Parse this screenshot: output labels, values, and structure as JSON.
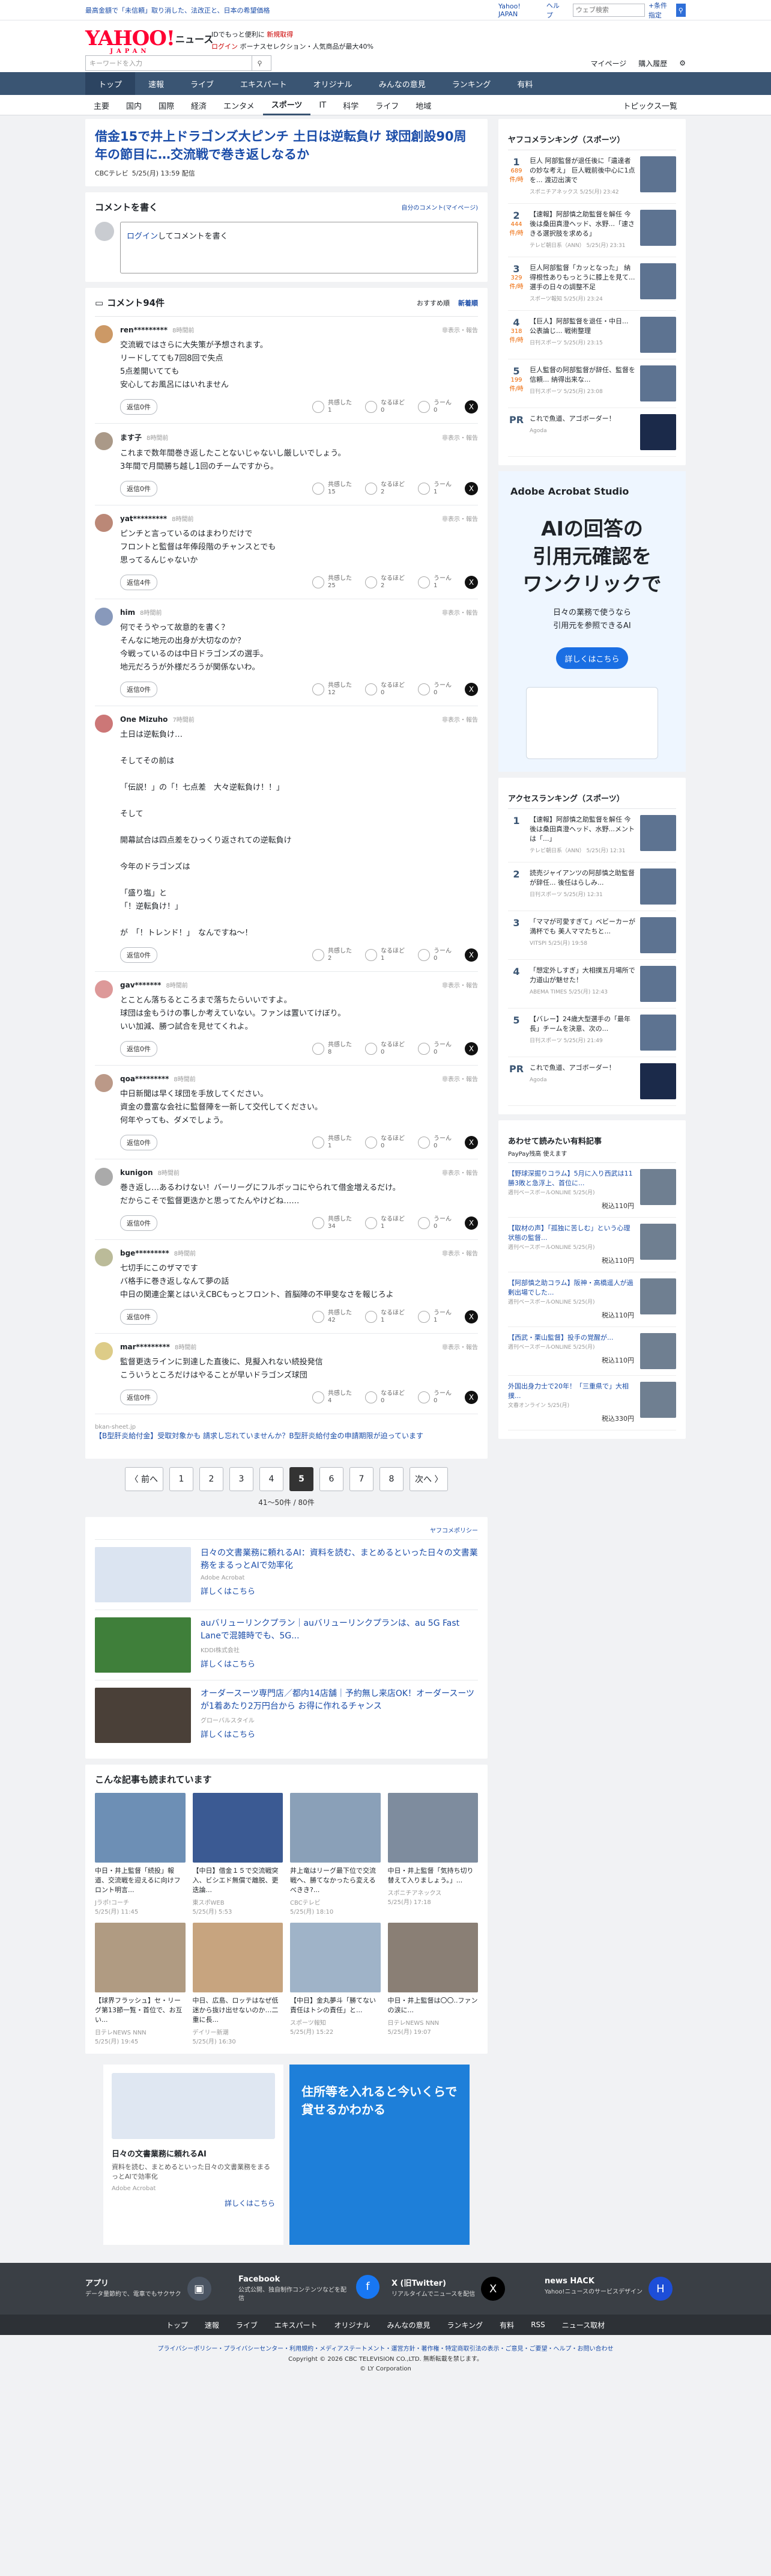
{
  "promo": {
    "text": "最高金額で「未信頼」取り消した、法改正と、日本の希望価格",
    "yahoo_japan": "Yahoo! JAPAN",
    "help": "ヘルプ",
    "search_placeholder": "ウェブ検索",
    "advanced": "+条件指定"
  },
  "header": {
    "logo": "YAHOO!",
    "logo_sub": "JAPAN",
    "service": "ニュース",
    "msg1": "IDでもっと便利に",
    "msg1b": "新規取得",
    "msg2a": "ログイン",
    "msg2b": "ボーナスセレクション・人気商品が最大40%",
    "search_placeholder": "キーワードを入力",
    "mypage": "マイページ",
    "purchase": "購入履歴"
  },
  "topnav": [
    "トップ",
    "速報",
    "ライブ",
    "エキスパート",
    "オリジナル",
    "みんなの意見",
    "ランキング",
    "有料"
  ],
  "catnav": [
    "主要",
    "国内",
    "国際",
    "経済",
    "エンタメ",
    "スポーツ",
    "IT",
    "科学",
    "ライフ",
    "地域"
  ],
  "catnav_last": "トピックス一覧",
  "article": {
    "title": "借金15で井上ドラゴンズ大ピンチ 土日は逆転負け 球団創設90周年の節目に…交流戦で巻き返しなるか",
    "source": "CBCテレビ",
    "date": "5/25(月) 13:59 配信"
  },
  "comment_write": {
    "heading": "コメントを書く",
    "mine": "自分のコメント(マイページ)",
    "placeholder_link": "ログイン",
    "placeholder": "してコメントを書く"
  },
  "comments_head": {
    "title": "コメント94件",
    "sort1": "おすすめ順",
    "sort2": "新着順"
  },
  "comments": [
    {
      "name": "ren*********",
      "time": "8時間前",
      "text": "交流戦ではさらに大失策が予想されます。\nリードしてても7回8回で失点\n5点差開いてても\n安心してお風呂にはいれません",
      "reply": "返信0件",
      "agree": "共感した\n1",
      "insight": "なるほど\n0",
      "hmm": "うーん\n0",
      "color": "#c96"
    },
    {
      "name": "ます子",
      "time": "8時間前",
      "text": "これまで数年間巻き返したことないじゃないし厳しいでしょう。\n3年間で月間勝ち越し1回のチームですから。",
      "reply": "返信0件",
      "agree": "共感した\n15",
      "insight": "なるほど\n2",
      "hmm": "うーん\n1",
      "color": "#a98"
    },
    {
      "name": "yat*********",
      "time": "8時間前",
      "text": "ピンチと言っているのはまわりだけで\nフロントと監督は年俸段階のチャンスとでも\n思ってるんじゃないか",
      "reply": "返信4件",
      "agree": "共感した\n25",
      "insight": "なるほど\n2",
      "hmm": "うーん\n1",
      "color": "#b87"
    },
    {
      "name": "him",
      "time": "8時間前",
      "text": "何でそうやって故意的を書く？\nそんなに地元の出身が大切なのか？\n今戦っているのは中日ドラゴンズの選手。\n地元だろうが外様だろうが関係ないわ。",
      "reply": "返信0件",
      "agree": "共感した\n12",
      "insight": "なるほど\n0",
      "hmm": "うーん\n0",
      "color": "#89b"
    },
    {
      "name": "One Mizuho",
      "time": "7時間前",
      "text": "土日は逆転負け…\n\nそしてその前は\n\n「伝説！」の「！七点差　大々逆転負け！！」\n\nそして\n\n開幕試合は四点差をひっくり返されての逆転負け\n\n今年のドラゴンズは\n\n「盛り塩」と\n「！逆転負け！」\n\nが　「！トレンド！」　なんですね～！",
      "reply": "返信0件",
      "agree": "共感した\n2",
      "insight": "なるほど\n1",
      "hmm": "うーん\n0",
      "color": "#c77"
    },
    {
      "name": "gav*******",
      "time": "8時間前",
      "text": "とことん落ちるところまで落ちたらいいですよ。\n球団は金もうけの事しか考えていない。ファンは置いてけぼり。\nいい加減、勝つ試合を見せてくれよ。",
      "reply": "返信0件",
      "agree": "共感した\n8",
      "insight": "なるほど\n0",
      "hmm": "うーん\n0",
      "color": "#d99"
    },
    {
      "name": "qoa*********",
      "time": "8時間前",
      "text": "中日新聞は早く球団を手放してください。\n資金の豊富な会社に監督陣を一新して交代してください。\n何年やっても、ダメでしょう。",
      "reply": "返信0件",
      "agree": "共感した\n1",
      "insight": "なるほど\n0",
      "hmm": "うーん\n0",
      "color": "#b98"
    },
    {
      "name": "kunigon",
      "time": "8時間前",
      "text": "巻き返し…あるわけない！バーリーグにフルボッコにやられて借金増えるだけ。\nだからこそで監督更迭かと思ってたんやけどね……",
      "reply": "返信0件",
      "agree": "共感した\n34",
      "insight": "なるほど\n1",
      "hmm": "うーん\n0",
      "color": "#aaa"
    },
    {
      "name": "bge*********",
      "time": "8時間前",
      "text": "七切手にこのザマです\nバ格手に巻き返しなんて夢の話\n中日の関連企業とはいえCBCもっとフロント、首脳陣の不甲斐なさを報じろよ",
      "reply": "返信0件",
      "agree": "共感した\n42",
      "insight": "なるほど\n1",
      "hmm": "うーん\n1",
      "color": "#bb9"
    },
    {
      "name": "mar*********",
      "time": "8時間前",
      "text": "監督更迭ラインに到達した直後に、見擬入れない続投発信\nこういうところだけはやることが早いドラゴンズ球団",
      "reply": "返信0件",
      "agree": "共感した\n4",
      "insight": "なるほど\n0",
      "hmm": "うーん\n0",
      "color": "#dc8"
    }
  ],
  "comment_ad": {
    "label": "bkan-sheet.jp",
    "text": "【B型肝炎給付金】受取対象かも 請求し忘れていませんか？B型肝炎給付金の申請期限が迫っています"
  },
  "pager": {
    "prev": "〈 前へ",
    "pages": [
      "1",
      "2",
      "3",
      "4",
      "5",
      "6",
      "7",
      "8"
    ],
    "next": "次へ 〉",
    "count": "41～50件 / 80件"
  },
  "native_ads": {
    "policy": "ヤフコメポリシー",
    "items": [
      {
        "title": "日々の文書業務に頼れるAI：資料を読む、まとめるといった日々の文書業務をまるっとAIで効率化",
        "sponsor": "Adobe Acrobat",
        "link": "詳しくはこちら"
      },
      {
        "title": "auバリューリンクプラン｜auバリューリンクプランは、au 5G Fast Laneで混雑時でも、5G...",
        "sponsor": "KDDI株式会社",
        "link": "詳しくはこちら"
      },
      {
        "title": "オーダースーツ専門店／都内14店舗｜予約無し来店OK！オーダースーツが1着あたり2万円台から お得に作れるチャンス",
        "sponsor": "グローバルスタイル",
        "link": "詳しくはこちら"
      }
    ]
  },
  "also_read": {
    "heading": "こんな記事も読まれています",
    "items": [
      {
        "title": "中日・井上監督「続投」報道、交流戦を迎えるに向けフロント明言...",
        "src": "Jラポ!コーチ",
        "date": "5/25(月) 11:45"
      },
      {
        "title": "【中日】借金１５で交流戦突入、ビシエド無償で離脱、更迭論...",
        "src": "東スポWEB",
        "date": "5/25(月) 5:53"
      },
      {
        "title": "井上竜はリーグ最下位で交流戦へ、勝てなかったら変えるべきき?...",
        "src": "CBCテレビ",
        "date": "5/25(月) 18:10"
      },
      {
        "title": "中日・井上監督「気持ち切り替えて入りましょう。」...",
        "src": "スポニチアネックス",
        "date": "5/25(月) 17:18"
      },
      {
        "title": "【球界フラッシュ】セ・リーグ第13節一覧・首位で、お互い...",
        "src": "日テレNEWS NNN",
        "date": "5/25(月) 19:45"
      },
      {
        "title": "中日、広島、ロッテはなぜ低迷から抜け出せないのか…二重に長...",
        "src": "デイリー新潮",
        "date": "5/25(月) 16:30"
      },
      {
        "title": "【中日】金丸夢斗「勝てない責任はトシの責任」と...",
        "src": "スポーツ報知",
        "date": "5/25(月) 15:22"
      },
      {
        "title": "中日・井上監督は〇〇..ファンの涙に...",
        "src": "日テレNEWS NNN",
        "date": "5/25(月) 19:07"
      }
    ]
  },
  "right_rank": {
    "heading": "ヤフコメランキング（スポーツ）",
    "items": [
      {
        "n": "1",
        "c": "689",
        "unit": "件/時",
        "t": "巨人 阿部監督が退任後に「遺達者の妙な考え」 巨人戦前後中心に1点を... 渡辺出演で",
        "s": "スポニチアネックス 5/25(月) 23:42"
      },
      {
        "n": "2",
        "c": "444",
        "unit": "件/時",
        "t": "【速報】阿部慎之助監督を解任 今後は桑田真澄ヘッド、水野...「速さきる選択肢を求める」",
        "s": "テレビ朝日系（ANN） 5/25(月) 23:31"
      },
      {
        "n": "3",
        "c": "329",
        "unit": "件/時",
        "t": "巨人阿部監督「カッとなった」 納得根性ありもっとうに膝上を見て... 選手の日々の調整不足",
        "s": "スポーツ報知 5/25(月) 23:24"
      },
      {
        "n": "4",
        "c": "318",
        "unit": "件/時",
        "t": "【巨人】阿部監督を退任・中日... 公表論じ... 戦術整理",
        "s": "日刊スポーツ 5/25(月) 23:15"
      },
      {
        "n": "5",
        "c": "199",
        "unit": "件/時",
        "t": "巨人監督の阿部監督が辞任、監督を信頼... 納得出来な...",
        "s": "日刊スポーツ 5/25(月) 23:08"
      }
    ],
    "pr": "これで魚道、アゴボーダー！",
    "pr_sub": "Agoda"
  },
  "cta_ad": {
    "brand": "Adobe Acrobat Studio",
    "big": "AIの回答の\n引用元確認を\nワンクリックで",
    "sub": "日々の業務で使うなら\n引用元を参照できるAI",
    "btn": "詳しくはこちら"
  },
  "access_rank": {
    "heading": "アクセスランキング（スポーツ）",
    "items": [
      {
        "n": "1",
        "t": "【速報】阿部慎之助監督を解任 今後は桑田真澄ヘッド、水野...メントは「...」",
        "s": "テレビ朝日系（ANN） 5/25(月) 12:31"
      },
      {
        "n": "2",
        "t": "読売ジャイアンツの阿部慎之助監督が辞任... 後任はらしみ...",
        "s": "日刊スポーツ 5/25(月) 12:31"
      },
      {
        "n": "3",
        "t": "「ママが可愛すぎて」ベビーカーが満杯でも 美人ママたちと...",
        "s": "VITSPI 5/25(月) 19:58"
      },
      {
        "n": "4",
        "t": "「想定外しすぎ」大相撲五月場所で力道山が魅せた！",
        "s": "ABEMA TIMES 5/25(月) 12:43"
      },
      {
        "n": "5",
        "t": "【バレー】24歳大型選手の「最年長」チームを決意、次の...",
        "s": "日刊スポーツ 5/25(月) 21:49"
      }
    ],
    "pr": "これで魚道、アゴボーダー！",
    "pr_sub": "Agoda"
  },
  "pay": {
    "heading": "あわせて読みたい有料記事",
    "sub": "PayPay残高 使えます",
    "items": [
      {
        "t": "【野球深掘りコラム】5月に入り西武は11勝3敗と急浮上、首位に...",
        "s": "週刊ベースボールONLINE 5/25(月)",
        "p": "110"
      },
      {
        "t": "【取材の声】「孤独に苦しむ」という心理状態の監督...",
        "s": "週刊ベースボールONLINE 5/25(月)",
        "p": "110"
      },
      {
        "t": "【阿部慎之助コラム】阪神・高橋遥人が過剰出場でした...",
        "s": "週刊ベースボールONLINE 5/25(月)",
        "p": "110"
      },
      {
        "t": "【西武・栗山監督】投手の覚醒が...",
        "s": "週刊ベースボールONLINE 5/25(月)",
        "p": "110"
      },
      {
        "t": "外国出身力士で20年！「三重県で」大相撲...",
        "s": "文春オンライン 5/25(月)",
        "p": "330"
      }
    ]
  },
  "bottom_ads": {
    "left_title": "日々の文書業務に頼れるAI",
    "left_text": "資料を読む、まとめるといった日々の文書業務をまるっとAIで効率化",
    "left_sponsor": "Adobe Acrobat",
    "left_link": "詳しくはこちら",
    "right_big": "住所等を入れると今いくらで貸せるかわかる"
  },
  "footer": {
    "items": [
      {
        "t": "アプリ",
        "d": "データ量節約で、電車でもサクサク"
      },
      {
        "t": "Facebook",
        "d": "公式公開、独自制作コンテンツなどを配信"
      },
      {
        "t": "X (旧Twitter)",
        "d": "リアルタイムでニュースを配信"
      },
      {
        "t": "news HACK",
        "d": "Yahoo!ニュースのサービスデザイン"
      }
    ],
    "nav": [
      "トップ",
      "速報",
      "ライブ",
      "エキスパート",
      "オリジナル",
      "みんなの意見",
      "ランキング",
      "有料",
      "RSS",
      "ニュース取材"
    ],
    "links": "プライバシーポリシー・プライバシーセンター・利用規約・メディアステートメント・運営方針・著作権・特定商取引法の表示・ご意見・ご要望・ヘルプ・お問い合わせ",
    "copy1": "Copyright © 2026 CBC TELEVISION CO.,LTD. 無断転載を禁じます。",
    "copy2": "© LY Corporation"
  },
  "colors": {
    "accent": "#1a4ca8",
    "nav": "#3a5573",
    "brand_red": "#ff0033"
  }
}
